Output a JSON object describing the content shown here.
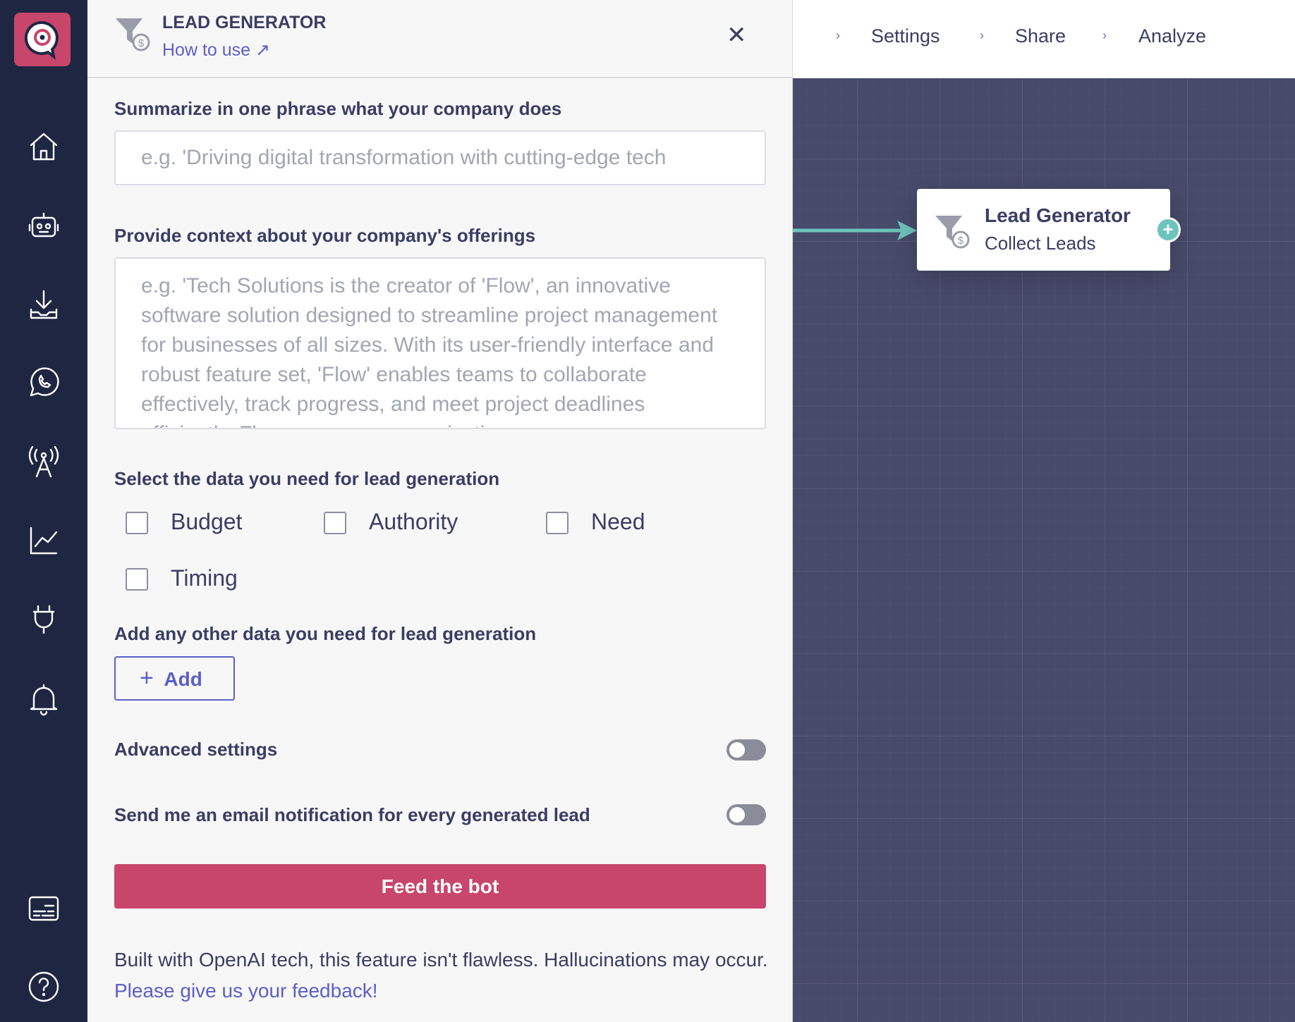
{
  "colors": {
    "accent": "#c8456b",
    "sidebar": "#1e2642",
    "canvas": "#474a6a",
    "link": "#5b5fc7",
    "connector": "#6cc4bc"
  },
  "sidebar": {
    "items": [
      {
        "icon": "home-icon"
      },
      {
        "icon": "robot-icon"
      },
      {
        "icon": "download-icon"
      },
      {
        "icon": "whatsapp-icon"
      },
      {
        "icon": "broadcast-icon"
      },
      {
        "icon": "analytics-icon"
      },
      {
        "icon": "plug-icon"
      },
      {
        "icon": "bell-icon"
      },
      {
        "icon": "subtitles-icon"
      },
      {
        "icon": "help-icon"
      }
    ]
  },
  "breadcrumb": {
    "items": [
      "Settings",
      "Share",
      "Analyze"
    ]
  },
  "panel": {
    "title": "LEAD GENERATOR",
    "how_to_use": "How to use",
    "q1": {
      "label": "Summarize in one phrase what your company does",
      "placeholder": "e.g. 'Driving digital transformation with cutting-edge tech"
    },
    "q2": {
      "label": "Provide context about your company's offerings",
      "placeholder": "e.g. 'Tech Solutions is the creator of 'Flow', an innovative software solution designed to streamline project management for businesses of all sizes. With its user-friendly interface and robust feature set, 'Flow' enables teams to collaborate effectively, track progress, and meet project deadlines efficiently. Flow empowers organizations"
    },
    "q3": {
      "label": "Select the data you need for lead generation",
      "options": [
        {
          "label": "Budget",
          "checked": false
        },
        {
          "label": "Authority",
          "checked": false
        },
        {
          "label": "Need",
          "checked": false
        },
        {
          "label": "Timing",
          "checked": false
        }
      ]
    },
    "q4": {
      "label": "Add any other data you need for lead generation",
      "add": "Add"
    },
    "advanced": {
      "label": "Advanced settings",
      "on": false
    },
    "email": {
      "label": "Send me an email notification for every generated lead",
      "on": false
    },
    "submit": "Feed the bot",
    "footer": {
      "text": "Built with OpenAI tech, this feature isn't flawless. Hallucinations may occur.",
      "link": "Please give us your feedback!"
    }
  },
  "node": {
    "title": "Lead Generator",
    "subtitle": "Collect Leads"
  }
}
